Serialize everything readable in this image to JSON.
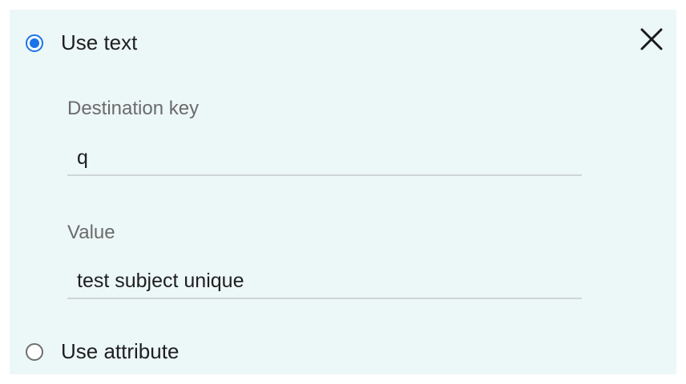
{
  "options": {
    "use_text_label": "Use text",
    "use_attribute_label": "Use attribute",
    "selected": "use_text"
  },
  "fields": {
    "destination_key_label": "Destination key",
    "destination_key_value": "q",
    "value_label": "Value",
    "value_value": "test subject unique"
  },
  "icons": {
    "close": "close-icon"
  },
  "colors": {
    "panel_background": "#ecf7f7",
    "radio_selected": "#1a73e8",
    "label_gray": "#6b6b6b"
  }
}
